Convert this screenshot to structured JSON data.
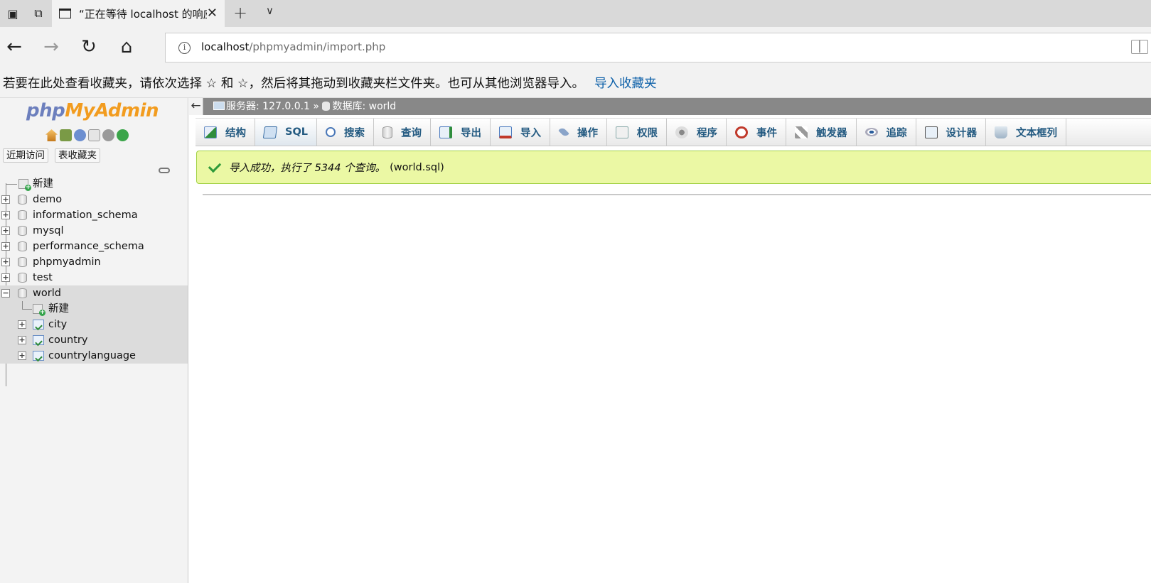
{
  "browser": {
    "tab_title": "“正在等待 localhost 的响应",
    "url_host": "localhost",
    "url_path": "/phpmyadmin/import.php",
    "favorites_bar_text": "若要在此处查看收藏夹，请依次选择 ☆ 和 ☆，然后将其拖动到收藏夹栏文件夹。也可从其他浏览器导入。",
    "favorites_import_link": "导入收藏夹"
  },
  "pma": {
    "logo": {
      "php": "php",
      "my": "My",
      "admin": "Admin"
    },
    "recent_label": "近期访问",
    "favorites_label": "表收藏夹",
    "tree": {
      "new_db": "新建",
      "databases": [
        "demo",
        "information_schema",
        "mysql",
        "performance_schema",
        "phpmyadmin",
        "test"
      ],
      "selected_db": "world",
      "selected_new": "新建",
      "tables": [
        "city",
        "country",
        "countrylanguage"
      ]
    },
    "breadcrumb": {
      "server": "服务器: 127.0.0.1",
      "sep": "»",
      "database": "数据库: world"
    },
    "menu": [
      {
        "key": "structure",
        "label": "结构",
        "icon": "structure-icon"
      },
      {
        "key": "sql",
        "label": "SQL",
        "icon": "sql-icon"
      },
      {
        "key": "search",
        "label": "搜索",
        "icon": "search-icon"
      },
      {
        "key": "query",
        "label": "查询",
        "icon": "query-icon"
      },
      {
        "key": "export",
        "label": "导出",
        "icon": "export-icon"
      },
      {
        "key": "import",
        "label": "导入",
        "icon": "import-icon"
      },
      {
        "key": "operations",
        "label": "操作",
        "icon": "operations-icon"
      },
      {
        "key": "privileges",
        "label": "权限",
        "icon": "privileges-icon"
      },
      {
        "key": "routines",
        "label": "程序",
        "icon": "routines-icon"
      },
      {
        "key": "events",
        "label": "事件",
        "icon": "events-icon"
      },
      {
        "key": "triggers",
        "label": "触发器",
        "icon": "triggers-icon"
      },
      {
        "key": "tracking",
        "label": "追踪",
        "icon": "tracking-icon"
      },
      {
        "key": "designer",
        "label": "设计器",
        "icon": "designer-icon"
      },
      {
        "key": "central_columns",
        "label": "文本框列",
        "icon": "central-columns-icon"
      }
    ],
    "success_message": "导入成功，执行了 5344 个查询。",
    "success_file": "(world.sql)"
  }
}
